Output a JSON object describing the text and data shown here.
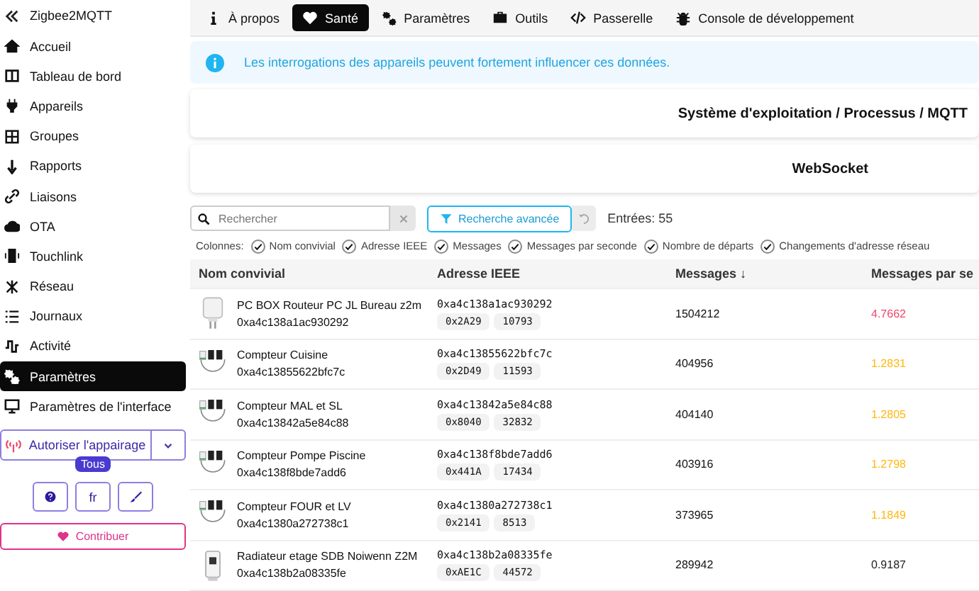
{
  "sidebar": {
    "title": "Zigbee2MQTT",
    "items": [
      {
        "label": "Accueil",
        "selected": false
      },
      {
        "label": "Tableau de bord",
        "selected": false
      },
      {
        "label": "Appareils",
        "selected": false
      },
      {
        "label": "Groupes",
        "selected": false
      },
      {
        "label": "Rapports",
        "selected": false
      },
      {
        "label": "Liaisons",
        "selected": false
      },
      {
        "label": "OTA",
        "selected": false
      },
      {
        "label": "Touchlink",
        "selected": false
      },
      {
        "label": "Réseau",
        "selected": false
      },
      {
        "label": "Journaux",
        "selected": false
      },
      {
        "label": "Activité",
        "selected": false
      },
      {
        "label": "Paramètres",
        "selected": true
      },
      {
        "label": "Paramètres de l'interface",
        "selected": false
      }
    ],
    "pairing_button": "Autoriser l'appairage",
    "pairing_badge": "Tous",
    "language_button": "fr",
    "contribute_button": "Contribuer"
  },
  "tabs": [
    {
      "label": "À propos",
      "selected": false
    },
    {
      "label": "Santé",
      "selected": true
    },
    {
      "label": "Paramètres",
      "selected": false
    },
    {
      "label": "Outils",
      "selected": false
    },
    {
      "label": "Passerelle",
      "selected": false
    },
    {
      "label": "Console de développement",
      "selected": false
    }
  ],
  "alert": "Les interrogations des appareils peuvent fortement influencer ces données.",
  "sections": [
    "Système d'exploitation / Processus / MQTT",
    "WebSocket"
  ],
  "search": {
    "placeholder": "Rechercher"
  },
  "advanced_search_button": "Recherche avancée",
  "entries": "Entrées: 55",
  "columns_label": "Colonnes:",
  "column_toggles": [
    {
      "label": "Nom convivial",
      "checked": true
    },
    {
      "label": "Adresse IEEE",
      "checked": true
    },
    {
      "label": "Messages",
      "checked": true
    },
    {
      "label": "Messages par seconde",
      "checked": true
    },
    {
      "label": "Nombre de départs",
      "checked": true
    },
    {
      "label": "Changements d'adresse réseau",
      "checked": true
    }
  ],
  "table": {
    "columns": [
      "Nom convivial",
      "Adresse IEEE",
      "Messages ↓",
      "Messages par se"
    ],
    "rows": [
      {
        "kind": "plug",
        "name": "PC BOX Routeur PC JL Bureau z2m",
        "address": "0xa4c138a1ac930292",
        "ieee": "0xa4c138a1ac930292",
        "nwk": "0x2A29",
        "nwk_dec": "10793",
        "messages": "1504212",
        "rate": "4.7662",
        "color": "#f14668"
      },
      {
        "kind": "meter",
        "name": "Compteur Cuisine",
        "address": "0xa4c13855622bfc7c",
        "ieee": "0xa4c13855622bfc7c",
        "nwk": "0x2D49",
        "nwk_dec": "11593",
        "messages": "404956",
        "rate": "1.2831",
        "color": "#ffb70f"
      },
      {
        "kind": "meter",
        "name": "Compteur MAL et SL",
        "address": "0xa4c13842a5e84c88",
        "ieee": "0xa4c13842a5e84c88",
        "nwk": "0x8040",
        "nwk_dec": "32832",
        "messages": "404140",
        "rate": "1.2805",
        "color": "#ffb70f"
      },
      {
        "kind": "meter",
        "name": "Compteur Pompe Piscine",
        "address": "0xa4c138f8bde7add6",
        "ieee": "0xa4c138f8bde7add6",
        "nwk": "0x441A",
        "nwk_dec": "17434",
        "messages": "403916",
        "rate": "1.2798",
        "color": "#ffb70f"
      },
      {
        "kind": "meter",
        "name": "Compteur FOUR et LV",
        "address": "0xa4c1380a272738c1",
        "ieee": "0xa4c1380a272738c1",
        "nwk": "0x2141",
        "nwk_dec": "8513",
        "messages": "373965",
        "rate": "1.1849",
        "color": "#ffb70f"
      },
      {
        "kind": "radiator",
        "name": "Radiateur etage SDB Noiwenn Z2M",
        "address": "0xa4c138b2a08335fe",
        "ieee": "0xa4c138b2a08335fe",
        "nwk": "0xAE1C",
        "nwk_dec": "44572",
        "messages": "289942",
        "rate": "0.9187",
        "color": "#222222"
      }
    ]
  }
}
